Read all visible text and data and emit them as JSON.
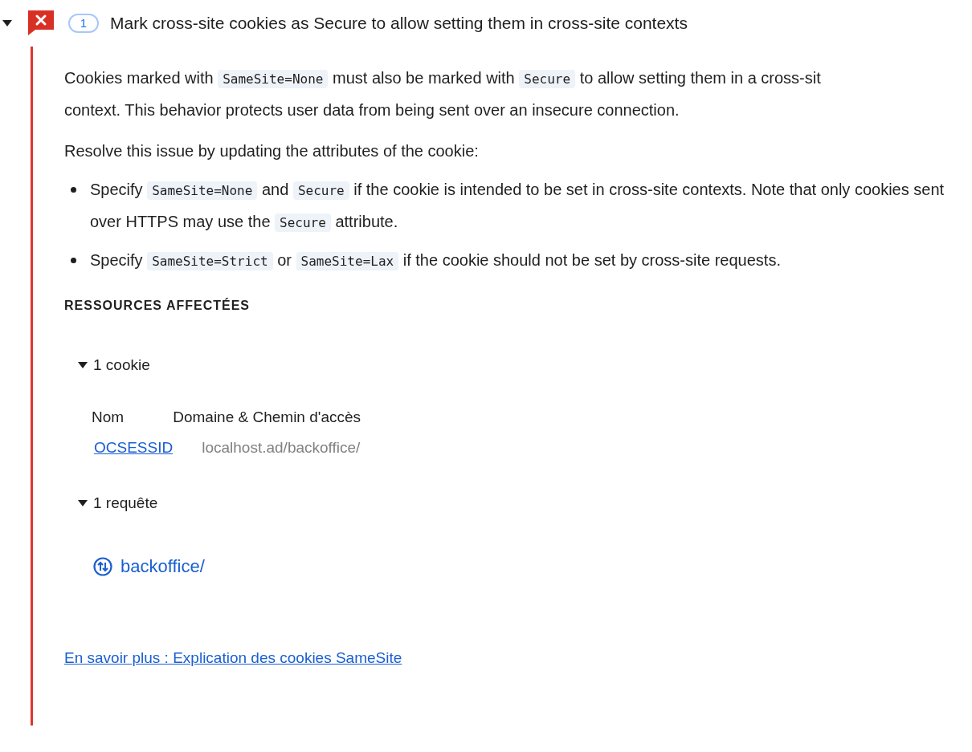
{
  "issue": {
    "expanded": true,
    "count": "1",
    "title": "Mark cross-site cookies as Secure to allow setting them in cross-site contexts"
  },
  "description": {
    "lines": [
      [
        {
          "kind": "text",
          "text": "Cookies marked with "
        },
        {
          "kind": "code",
          "text": "SameSite=None"
        },
        {
          "kind": "text",
          "text": " must also be marked with "
        },
        {
          "kind": "code",
          "text": "Secure"
        },
        {
          "kind": "text",
          "text": " to allow setting them in a cross-sit"
        }
      ],
      [
        {
          "kind": "text",
          "text": "context. This behavior protects user data from being sent over an insecure connection."
        }
      ]
    ]
  },
  "resolve_text": "Resolve this issue by updating the attributes of the cookie:",
  "bullets": [
    [
      {
        "kind": "text",
        "text": "Specify "
      },
      {
        "kind": "code",
        "text": "SameSite=None"
      },
      {
        "kind": "text",
        "text": " and "
      },
      {
        "kind": "code",
        "text": "Secure"
      },
      {
        "kind": "text",
        "text": " if the cookie is intended to be set in cross-site contexts. Note that only cookies sent over HTTPS may use the "
      },
      {
        "kind": "code",
        "text": "Secure"
      },
      {
        "kind": "text",
        "text": " attribute."
      }
    ],
    [
      {
        "kind": "text",
        "text": "Specify "
      },
      {
        "kind": "code",
        "text": "SameSite=Strict"
      },
      {
        "kind": "text",
        "text": " or "
      },
      {
        "kind": "code",
        "text": "SameSite=Lax"
      },
      {
        "kind": "text",
        "text": " if the cookie should not be set by cross-site requests."
      }
    ]
  ],
  "affected_heading": "RESSOURCES AFFECTÉES",
  "cookies": {
    "label": "1 cookie",
    "expanded": true,
    "columns": [
      "Nom",
      "Domaine & Chemin d'accès"
    ],
    "rows": [
      {
        "name": "OCSESSID",
        "domain_path": "localhost.ad/backoffice/"
      }
    ]
  },
  "requests": {
    "label": "1 requête",
    "expanded": true,
    "items": [
      {
        "url": "backoffice/"
      }
    ]
  },
  "learn_more": "En savoir plus : Explication des cookies SameSite"
}
